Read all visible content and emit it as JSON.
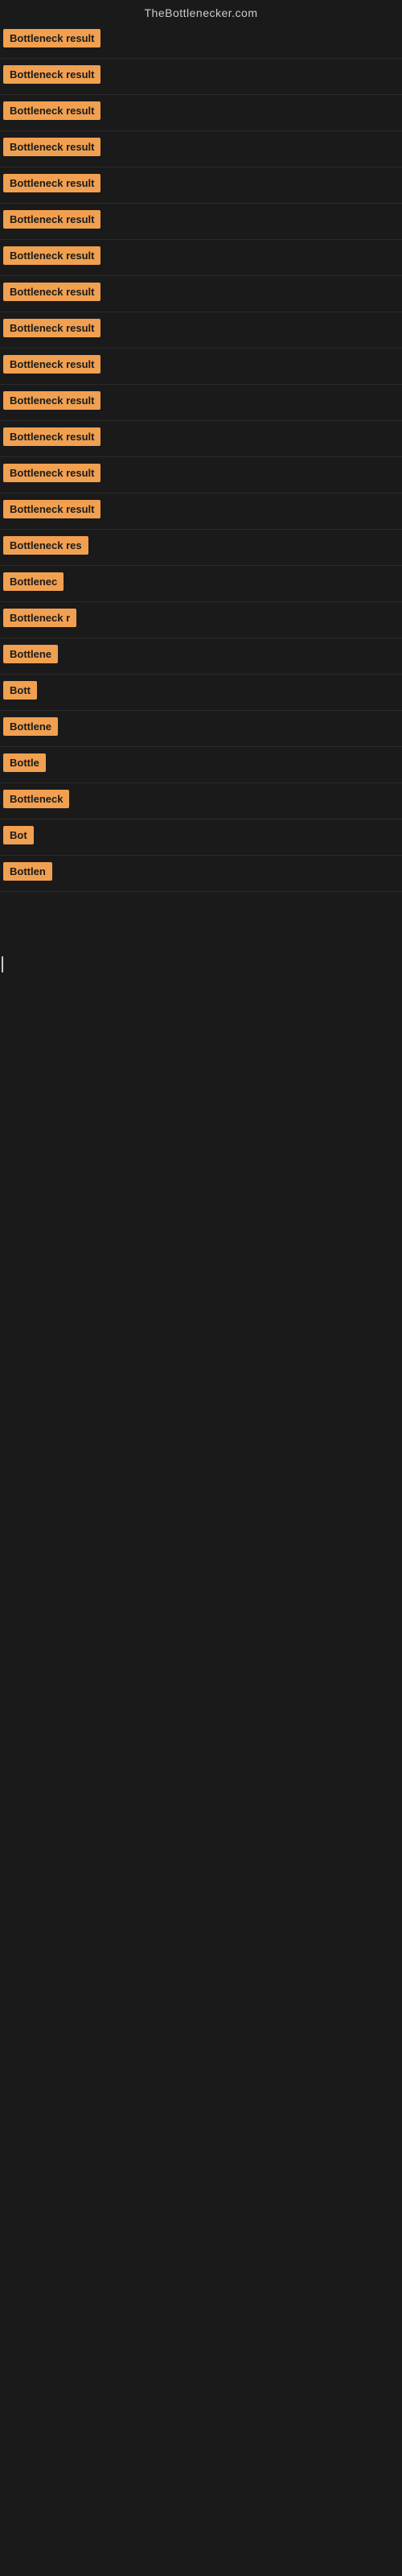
{
  "header": {
    "title": "TheBottlenecker.com"
  },
  "colors": {
    "badge_bg": "#f0a050",
    "badge_text": "#1a1a1a",
    "page_bg": "#1a1a1a",
    "header_text": "#cccccc"
  },
  "rows": [
    {
      "id": 1,
      "label": "Bottleneck result",
      "width": "full"
    },
    {
      "id": 2,
      "label": "Bottleneck result",
      "width": "full"
    },
    {
      "id": 3,
      "label": "Bottleneck result",
      "width": "full"
    },
    {
      "id": 4,
      "label": "Bottleneck result",
      "width": "full"
    },
    {
      "id": 5,
      "label": "Bottleneck result",
      "width": "full"
    },
    {
      "id": 6,
      "label": "Bottleneck result",
      "width": "full"
    },
    {
      "id": 7,
      "label": "Bottleneck result",
      "width": "full"
    },
    {
      "id": 8,
      "label": "Bottleneck result",
      "width": "full"
    },
    {
      "id": 9,
      "label": "Bottleneck result",
      "width": "full"
    },
    {
      "id": 10,
      "label": "Bottleneck result",
      "width": "full"
    },
    {
      "id": 11,
      "label": "Bottleneck result",
      "width": "full"
    },
    {
      "id": 12,
      "label": "Bottleneck result",
      "width": "full"
    },
    {
      "id": 13,
      "label": "Bottleneck result",
      "width": "full"
    },
    {
      "id": 14,
      "label": "Bottleneck result",
      "width": "full"
    },
    {
      "id": 15,
      "label": "Bottleneck res",
      "width": "partial"
    },
    {
      "id": 16,
      "label": "Bottlenec",
      "width": "partial2"
    },
    {
      "id": 17,
      "label": "Bottleneck r",
      "width": "partial3"
    },
    {
      "id": 18,
      "label": "Bottlene",
      "width": "partial4"
    },
    {
      "id": 19,
      "label": "Bott",
      "width": "tiny"
    },
    {
      "id": 20,
      "label": "Bottlene",
      "width": "partial4"
    },
    {
      "id": 21,
      "label": "Bottle",
      "width": "partial5"
    },
    {
      "id": 22,
      "label": "Bottleneck",
      "width": "partial6"
    },
    {
      "id": 23,
      "label": "Bot",
      "width": "tiny2"
    },
    {
      "id": 24,
      "label": "Bottlen",
      "width": "partial7"
    }
  ]
}
